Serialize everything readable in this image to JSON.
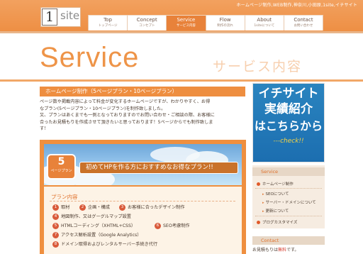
{
  "header": {
    "tagline": "ホームページ制作,WEB制作,神奈川,小田原,1site,イチサイト",
    "logo_mark": "1",
    "logo_word": "site"
  },
  "nav": [
    {
      "en": "Top",
      "jp": "トップページ",
      "active": false
    },
    {
      "en": "Concept",
      "jp": "コンセプト",
      "active": false
    },
    {
      "en": "Service",
      "jp": "サービス内容",
      "active": true
    },
    {
      "en": "Flow",
      "jp": "制作の流れ",
      "active": false
    },
    {
      "en": "About",
      "jp": "1siteについて",
      "active": false
    },
    {
      "en": "Contact",
      "jp": "お問い合わせ",
      "active": false
    }
  ],
  "hero": {
    "title": "Service",
    "subtitle_jp": "サービス内容"
  },
  "main": {
    "section_title": "ホームページ制作（5ページプラン・10ページプラン）",
    "intro_lines": [
      "ページ数や掲載内容によって料金が変化するホームページですが、わかりやすく、お得",
      "なプラン(5ページプラン・10ページプラン)を制作致しました。",
      "又、プランはあくまでも一例となっておりますのでお問い合わせ・ご相談の際、お客様に",
      "合ったお見積もりを作成させて頂きたいと思っております！5ページからでも制作致しま",
      "す！"
    ],
    "plan": {
      "badge_num": "5",
      "badge_label": "ページプラン",
      "banner": "初めてHPを作る方におすすめなお得なプラン!!",
      "heading": "プラン内容",
      "items": [
        {
          "n": "1",
          "text": "取材"
        },
        {
          "n": "2",
          "text": "企画・構成"
        },
        {
          "n": "3",
          "text": "お客様に合ったデザイン制作"
        },
        {
          "n": "4",
          "text": "地図制作、又はグーグルマップ設置"
        },
        {
          "n": "5",
          "text": "HTMLコーディング（XHTML+CSS）"
        },
        {
          "n": "6",
          "text": "SEO考慮制作"
        },
        {
          "n": "7",
          "text": "アクセス解析設置（Google Analytics）"
        },
        {
          "n": "8",
          "text": "ドメイン取得およびレンタルサーバー手続き代行"
        }
      ]
    }
  },
  "sidebar": {
    "promo": {
      "line1": "イチサイト",
      "line2": "実績紹介",
      "line3": "はこちらから",
      "line4": "---check!!"
    },
    "service_head": "Service",
    "links": [
      {
        "text": "ホームページ制作",
        "type": "dot"
      },
      {
        "text": "SEOについて",
        "type": "arrow"
      },
      {
        "text": "サーバー・ドメインについて",
        "type": "arrow"
      },
      {
        "text": "更新について",
        "type": "arrow"
      },
      {
        "text": "ブログカスタマイズ",
        "type": "dot"
      }
    ],
    "contact_head": "Contact",
    "contact_note_prefix": "お見積もりは",
    "contact_note_free": "無料",
    "contact_note_suffix": "です。"
  },
  "colors": {
    "accent": "#ee8e40",
    "promo_blue": "#1c6eb0"
  }
}
